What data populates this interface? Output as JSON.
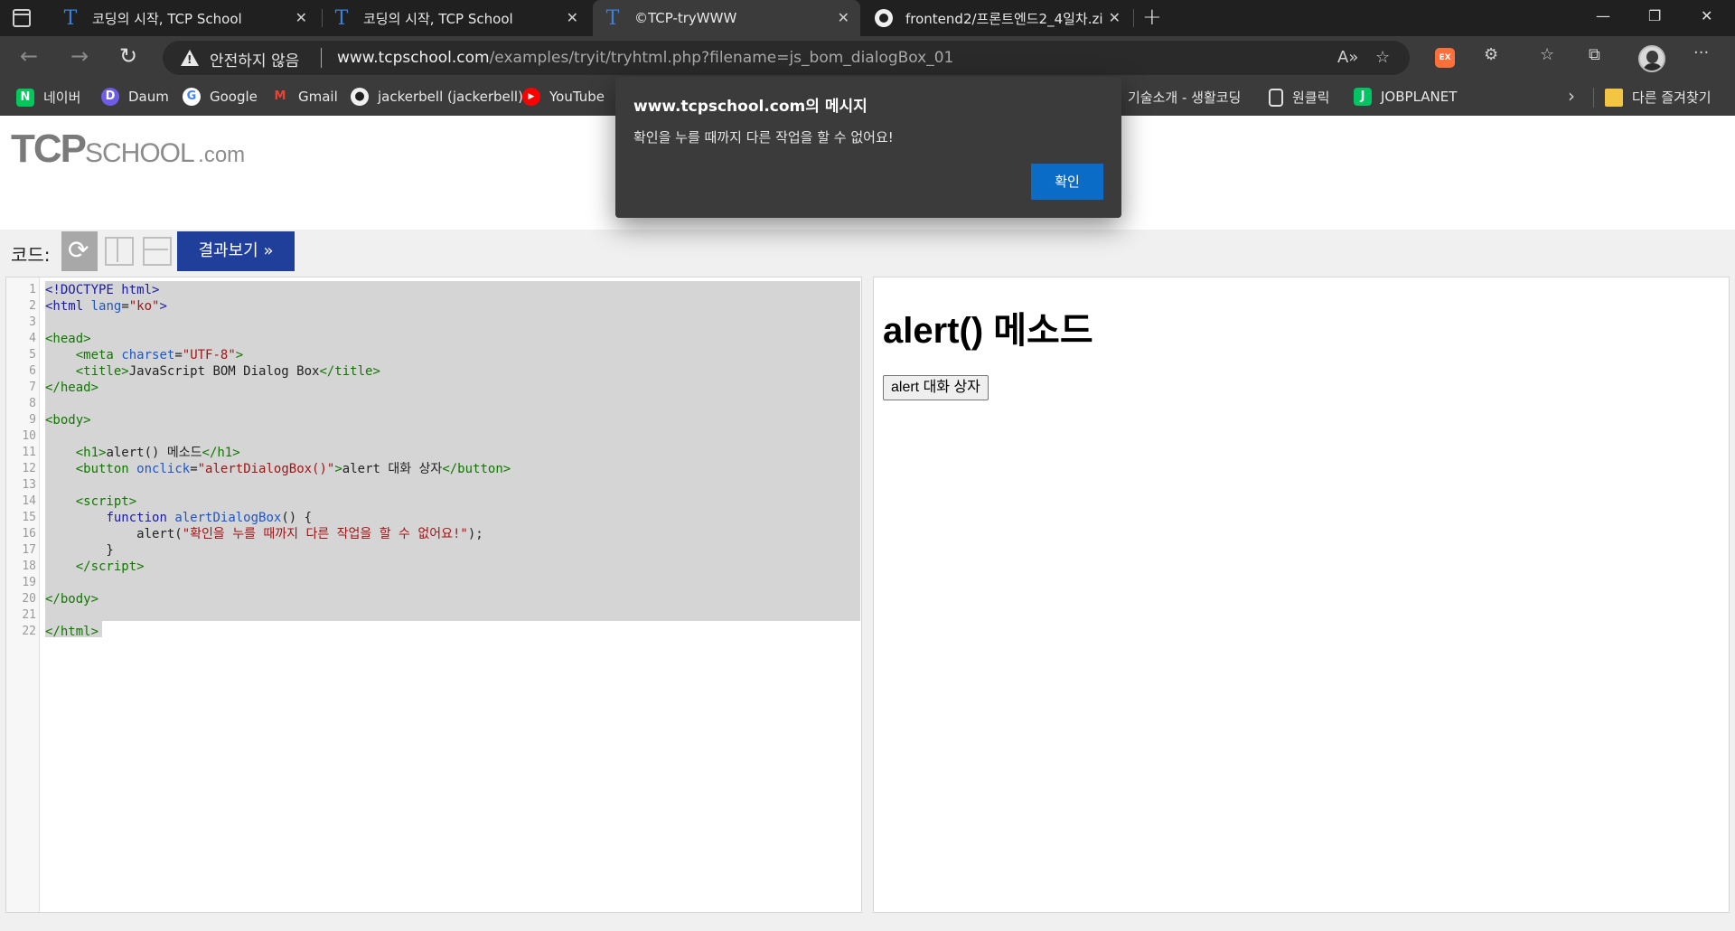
{
  "browser": {
    "tabs": [
      {
        "title": "코딩의 시작, TCP School",
        "favicon": "T"
      },
      {
        "title": "코딩의 시작, TCP School",
        "favicon": "T"
      },
      {
        "title": "©TCP-tryWWW",
        "favicon": "T"
      },
      {
        "title": "frontend2/프론트엔드2_4일차.zi",
        "favicon": "github-icon"
      }
    ],
    "security_label": "안전하지 않음",
    "url_host": "www.tcpschool.com",
    "url_path": "/examples/tryit/tryhtml.php?filename=js_bom_dialogBox_01",
    "bookmarks": [
      {
        "label": "네이버",
        "icon": "N"
      },
      {
        "label": "Daum",
        "icon": "D"
      },
      {
        "label": "Google",
        "icon": "G"
      },
      {
        "label": "Gmail",
        "icon": "M"
      },
      {
        "label": "jackerbell (jackerbell)",
        "icon": "github-icon"
      },
      {
        "label": "YouTube",
        "icon": "▶"
      },
      {
        "label": "기술소개 - 생활코딩",
        "icon": ""
      },
      {
        "label": "원클릭",
        "icon": "page-icon"
      },
      {
        "label": "JOBPLANET",
        "icon": "J"
      }
    ],
    "other_favorites": "다른 즐겨찾기",
    "extension_badge": "EX"
  },
  "site": {
    "logo_tcp": "TCP",
    "logo_school": "SCHOOL",
    "logo_com": ".com"
  },
  "toolbar": {
    "code_label": "코드:",
    "result_button": "결과보기 »"
  },
  "editor": {
    "line_numbers": [
      "1",
      "2",
      "3",
      "4",
      "5",
      "6",
      "7",
      "8",
      "9",
      "10",
      "11",
      "12",
      "13",
      "14",
      "15",
      "16",
      "17",
      "18",
      "19",
      "20",
      "21",
      "22"
    ]
  },
  "result": {
    "heading": "alert() 메소드",
    "button": "alert 대화 상자"
  },
  "dialog": {
    "title": "www.tcpschool.com의 메시지",
    "message": "확인을 누를 때까지 다른 작업을 할 수 없어요!",
    "ok_button": "확인"
  },
  "colors": {
    "result_button_bg": "#1f3f9b",
    "dialog_bg": "#3b3b3b",
    "ok_button_bg": "#0a6cc7",
    "code_tag": "#1a1aa6",
    "code_string": "#a31515"
  }
}
